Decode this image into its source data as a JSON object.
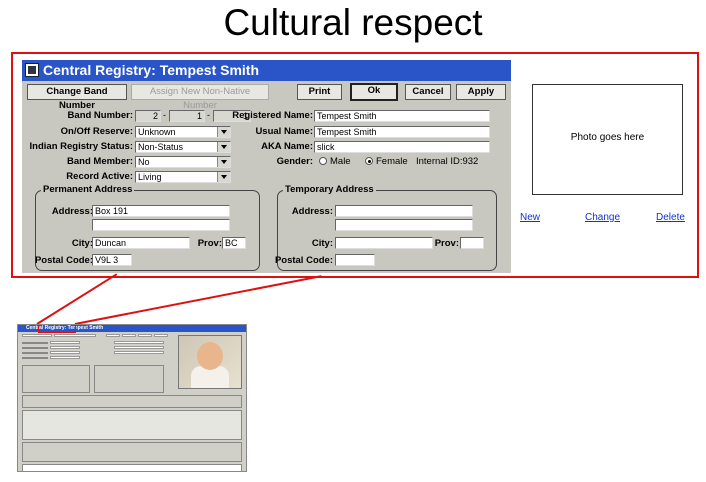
{
  "slide": {
    "title": "Cultural respect"
  },
  "window": {
    "title": "Central Registry: Tempest Smith",
    "toolbar": {
      "change_band": "Change Band Number",
      "assign_non_native": "Assign New Non-Native Number",
      "print": "Print",
      "ok": "Ok",
      "cancel": "Cancel",
      "apply": "Apply"
    },
    "form": {
      "band_number_label": "Band Number:",
      "band_number": [
        "2",
        "1",
        "1"
      ],
      "band_sep": "-",
      "reserve_label": "On/Off Reserve:",
      "reserve_value": "Unknown",
      "irs_label": "Indian Registry Status:",
      "irs_value": "Non-Status",
      "band_member_label": "Band Member:",
      "band_member_value": "No",
      "record_active_label": "Record Active:",
      "record_active_value": "Living",
      "registered_name_label": "Registered Name:",
      "registered_name": "Tempest Smith",
      "usual_name_label": "Usual Name:",
      "usual_name": "Tempest Smith",
      "aka_label": "AKA Name:",
      "aka": "slick",
      "gender_label": "Gender:",
      "gender_options": [
        "Male",
        "Female"
      ],
      "gender_selected": "Female",
      "internal_id": "Internal ID:932"
    },
    "permanent_address": {
      "title": "Permanent Address",
      "address_label": "Address:",
      "address1": "Box 191",
      "address2": "",
      "city_label": "City:",
      "city": "Duncan",
      "prov_label": "Prov:",
      "prov": "BC",
      "postal_label": "Postal Code:",
      "postal": "V9L 3"
    },
    "temporary_address": {
      "title": "Temporary Address",
      "address_label": "Address:",
      "address1": "",
      "address2": "",
      "city_label": "City:",
      "city": "",
      "prov_label": "Prov:",
      "prov": "",
      "postal_label": "Postal Code:",
      "postal": ""
    }
  },
  "photo": {
    "placeholder": "Photo goes here",
    "new_link": "New",
    "change_link": "Change",
    "delete_link": "Delete"
  },
  "colors": {
    "title_bar": "#2a55c8",
    "highlight": "#dd1111",
    "link": "#1133cc"
  }
}
